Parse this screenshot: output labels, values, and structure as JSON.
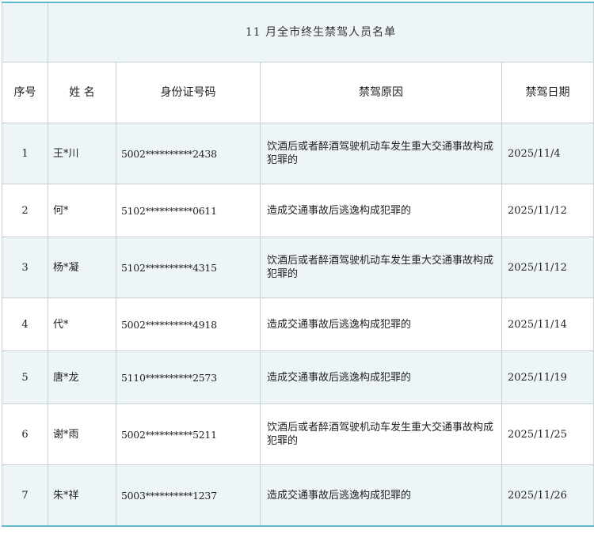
{
  "title": "11 月全市终生禁驾人员名单",
  "headers": {
    "no": "序号",
    "name": "姓 名",
    "id": "身份证号码",
    "reason": "禁驾原因",
    "date": "禁驾日期"
  },
  "rows": [
    {
      "no": "1",
      "name": "王*川",
      "id": "5002**********2438",
      "reason": "饮酒后或者醉酒驾驶机动车发生重大交通事故构成犯罪的",
      "date": "2025/11/4"
    },
    {
      "no": "2",
      "name": "何*",
      "id": "5102**********0611",
      "reason": "造成交通事故后逃逸构成犯罪的",
      "date": "2025/11/12"
    },
    {
      "no": "3",
      "name": "杨*凝",
      "id": "5102**********4315",
      "reason": "饮酒后或者醉酒驾驶机动车发生重大交通事故构成犯罪的",
      "date": "2025/11/12"
    },
    {
      "no": "4",
      "name": "代*",
      "id": "5002**********4918",
      "reason": "造成交通事故后逃逸构成犯罪的",
      "date": "2025/11/14"
    },
    {
      "no": "5",
      "name": "唐*龙",
      "id": "5110**********2573",
      "reason": "造成交通事故后逃逸构成犯罪的",
      "date": "2025/11/19"
    },
    {
      "no": "6",
      "name": "谢*雨",
      "id": "5002**********5211",
      "reason": "饮酒后或者醉酒驾驶机动车发生重大交通事故构成犯罪的",
      "date": "2025/11/25"
    },
    {
      "no": "7",
      "name": "朱*祥",
      "id": "5003**********1237",
      "reason": "造成交通事故后逃逸构成犯罪的",
      "date": "2025/11/26"
    }
  ]
}
